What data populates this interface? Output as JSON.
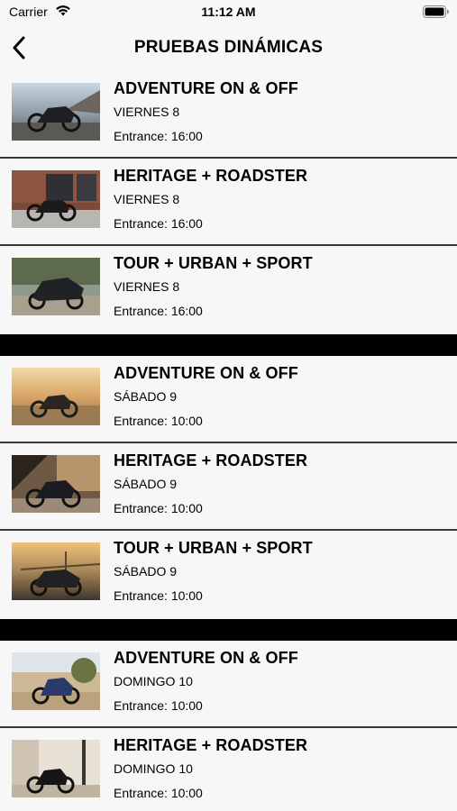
{
  "status": {
    "carrier": "Carrier",
    "time": "11:12 AM"
  },
  "nav": {
    "title": "PRUEBAS DINÁMICAS"
  },
  "groups": [
    {
      "items": [
        {
          "title": "ADVENTURE ON & OFF",
          "day": "VIERNES 8",
          "entrance": "Entrance: 16:00"
        },
        {
          "title": "HERITAGE + ROADSTER",
          "day": "VIERNES 8",
          "entrance": "Entrance: 16:00"
        },
        {
          "title": "TOUR + URBAN + SPORT",
          "day": "VIERNES 8",
          "entrance": "Entrance: 16:00"
        }
      ]
    },
    {
      "items": [
        {
          "title": "ADVENTURE ON & OFF",
          "day": "SÁBADO 9",
          "entrance": "Entrance: 10:00"
        },
        {
          "title": "HERITAGE + ROADSTER",
          "day": "SÁBADO 9",
          "entrance": "Entrance: 10:00"
        },
        {
          "title": "TOUR + URBAN + SPORT",
          "day": "SÁBADO 9",
          "entrance": "Entrance: 10:00"
        }
      ]
    },
    {
      "items": [
        {
          "title": "ADVENTURE ON & OFF",
          "day": "DOMINGO 10",
          "entrance": "Entrance: 10:00"
        },
        {
          "title": "HERITAGE + ROADSTER",
          "day": "DOMINGO 10",
          "entrance": "Entrance: 10:00"
        }
      ]
    }
  ]
}
